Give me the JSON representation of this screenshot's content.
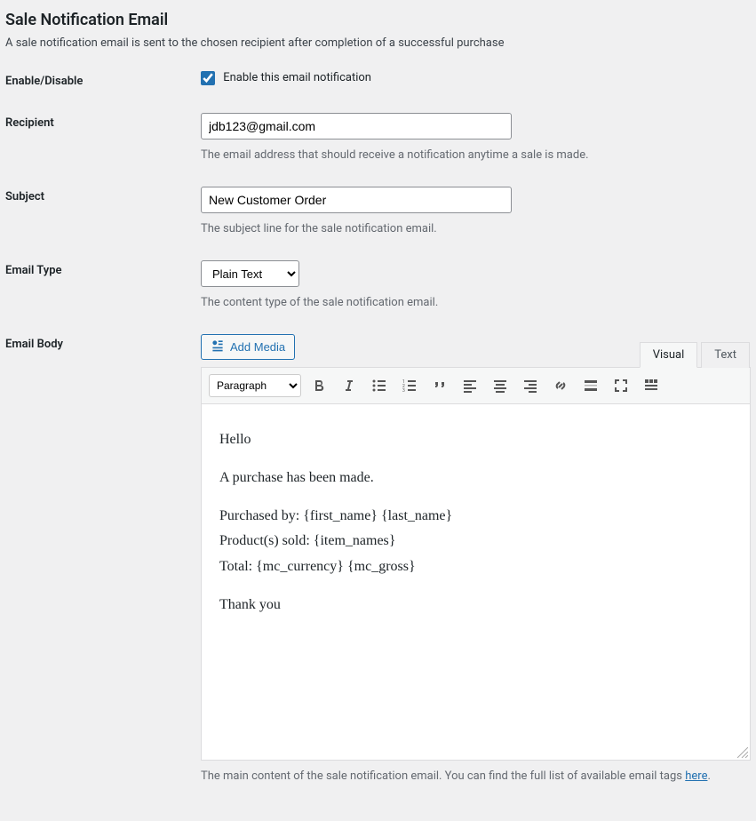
{
  "page": {
    "title": "Sale Notification Email",
    "description": "A sale notification email is sent to the chosen recipient after completion of a successful purchase"
  },
  "fields": {
    "enable": {
      "label": "Enable/Disable",
      "checkbox_label": "Enable this email notification",
      "checked": true
    },
    "recipient": {
      "label": "Recipient",
      "value": "jdb123@gmail.com",
      "help": "The email address that should receive a notification anytime a sale is made."
    },
    "subject": {
      "label": "Subject",
      "value": "New Customer Order",
      "help": "The subject line for the sale notification email."
    },
    "email_type": {
      "label": "Email Type",
      "selected": "Plain Text",
      "help": "The content type of the sale notification email."
    },
    "email_body": {
      "label": "Email Body",
      "add_media": "Add Media",
      "tabs": {
        "visual": "Visual",
        "text": "Text"
      },
      "format_selected": "Paragraph",
      "content": {
        "p1": "Hello",
        "p2": "A purchase has been made.",
        "p3_l1": "Purchased by: {first_name} {last_name}",
        "p3_l2": "Product(s) sold: {item_names}",
        "p3_l3": "Total: {mc_currency} {mc_gross}",
        "p4": "Thank you"
      },
      "footer_text": "The main content of the sale notification email. You can find the full list of available email tags ",
      "footer_link": "here"
    }
  }
}
